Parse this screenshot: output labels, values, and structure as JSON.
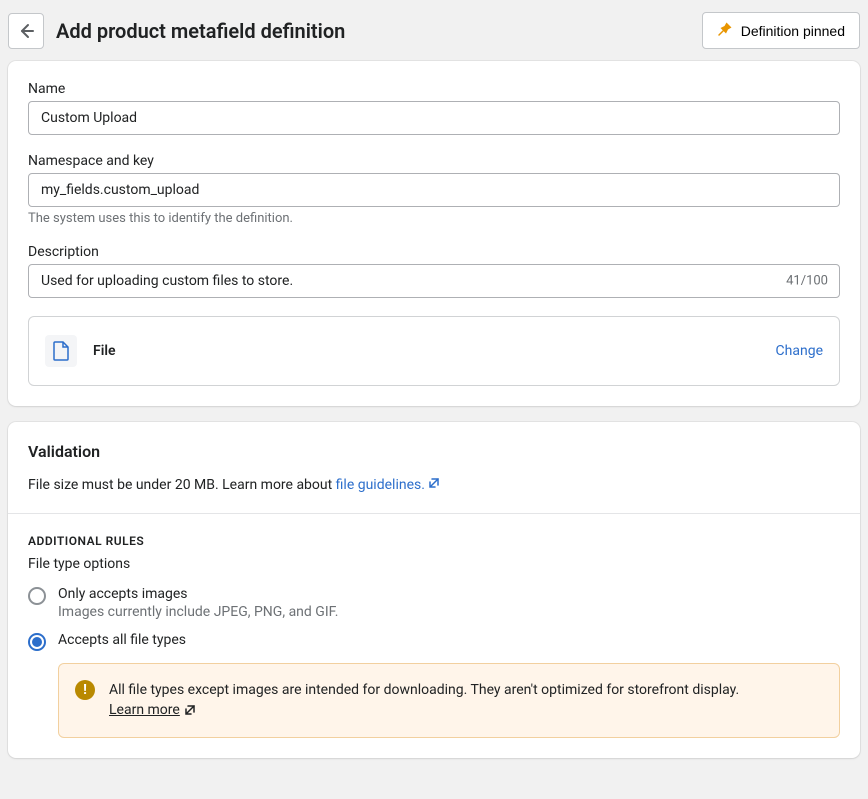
{
  "header": {
    "title": "Add product metafield definition",
    "pinned_label": "Definition pinned"
  },
  "form": {
    "name_label": "Name",
    "name_value": "Custom Upload",
    "namespace_label": "Namespace and key",
    "namespace_value": "my_fields.custom_upload",
    "namespace_help": "The system uses this to identify the definition.",
    "description_label": "Description",
    "description_value": "Used for uploading custom files to store.",
    "description_count": "41/100",
    "type_label": "File",
    "change_label": "Change"
  },
  "validation": {
    "heading": "Validation",
    "body_prefix": "File size must be under 20 MB. Learn more about ",
    "link_text": "file guidelines.",
    "additional_rules_heading": "ADDITIONAL RULES",
    "file_type_options_label": "File type options",
    "radios": {
      "only_images_label": "Only accepts images",
      "only_images_help": "Images currently include JPEG, PNG, and GIF.",
      "all_types_label": "Accepts all file types"
    },
    "warning": {
      "text": "All file types except images are intended for downloading. They aren't optimized for storefront display.",
      "learn_more": "Learn more"
    }
  }
}
